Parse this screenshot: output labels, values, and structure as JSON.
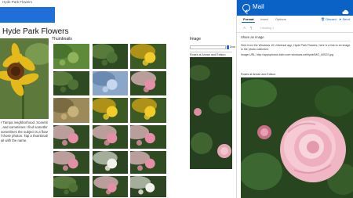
{
  "app": {
    "window_title": "Hyde Park Flowers",
    "heading": "Hyde Park Flowers",
    "description_lines": [
      "r Tampa neighborhood. Sometimes",
      ", and sometimes I find something to",
      "sometimes the subject is a flower.",
      "f those photos. Tap a thumbnail to",
      "ail with the name."
    ],
    "thumbnails_label": "Thumbnails",
    "image_label": "Image",
    "image_field_value": "",
    "image_field_side_text": "Dow",
    "image_caption": "Roses at Annan and Edison"
  },
  "thumbnails": [
    {
      "name": "garden-lawn",
      "kind": "garden"
    },
    {
      "name": "dark-shrubs",
      "kind": "leaves"
    },
    {
      "name": "yellow-lily",
      "kind": "yellow"
    },
    {
      "name": "plant-pot",
      "kind": "leaves"
    },
    {
      "name": "blue-flowers",
      "kind": "blue"
    },
    {
      "name": "pink-rose",
      "kind": "pink"
    },
    {
      "name": "dry-leaves",
      "kind": "tan"
    },
    {
      "name": "yellow-buttons",
      "kind": "yellow"
    },
    {
      "name": "yellow-pansies",
      "kind": "yellow"
    },
    {
      "name": "pink-bush",
      "kind": "pink"
    },
    {
      "name": "lavender-bush",
      "kind": "pink"
    },
    {
      "name": "red-bloom",
      "kind": "pink"
    },
    {
      "name": "pink-hibiscus",
      "kind": "pink"
    },
    {
      "name": "white-daisies",
      "kind": "white"
    },
    {
      "name": "small-pink-rose",
      "kind": "pink"
    },
    {
      "name": "leafy-plant",
      "kind": "leaves"
    },
    {
      "name": "red-petunias",
      "kind": "pink"
    },
    {
      "name": "white-blooms",
      "kind": "white"
    }
  ],
  "mail": {
    "title": "Mail",
    "tabs": [
      "Format",
      "Insert",
      "Options"
    ],
    "discard": "Discard",
    "send": "Send",
    "heading_style": "Heading 1",
    "subject": "Share an image",
    "body_lines": [
      "Sent from the Windows 10 Universal app, Hyde Park Flowers, here is a link to an image in the",
      "photo collection:"
    ],
    "image_url": "Image URL: http://appsphotos.blob.core.windows.net/hpfa/IMG_00022.jpg",
    "image_caption": "Roses at Annan and Edison"
  },
  "colors": {
    "accent": "#1e6fd9",
    "mail_header": "#0a62c7"
  }
}
